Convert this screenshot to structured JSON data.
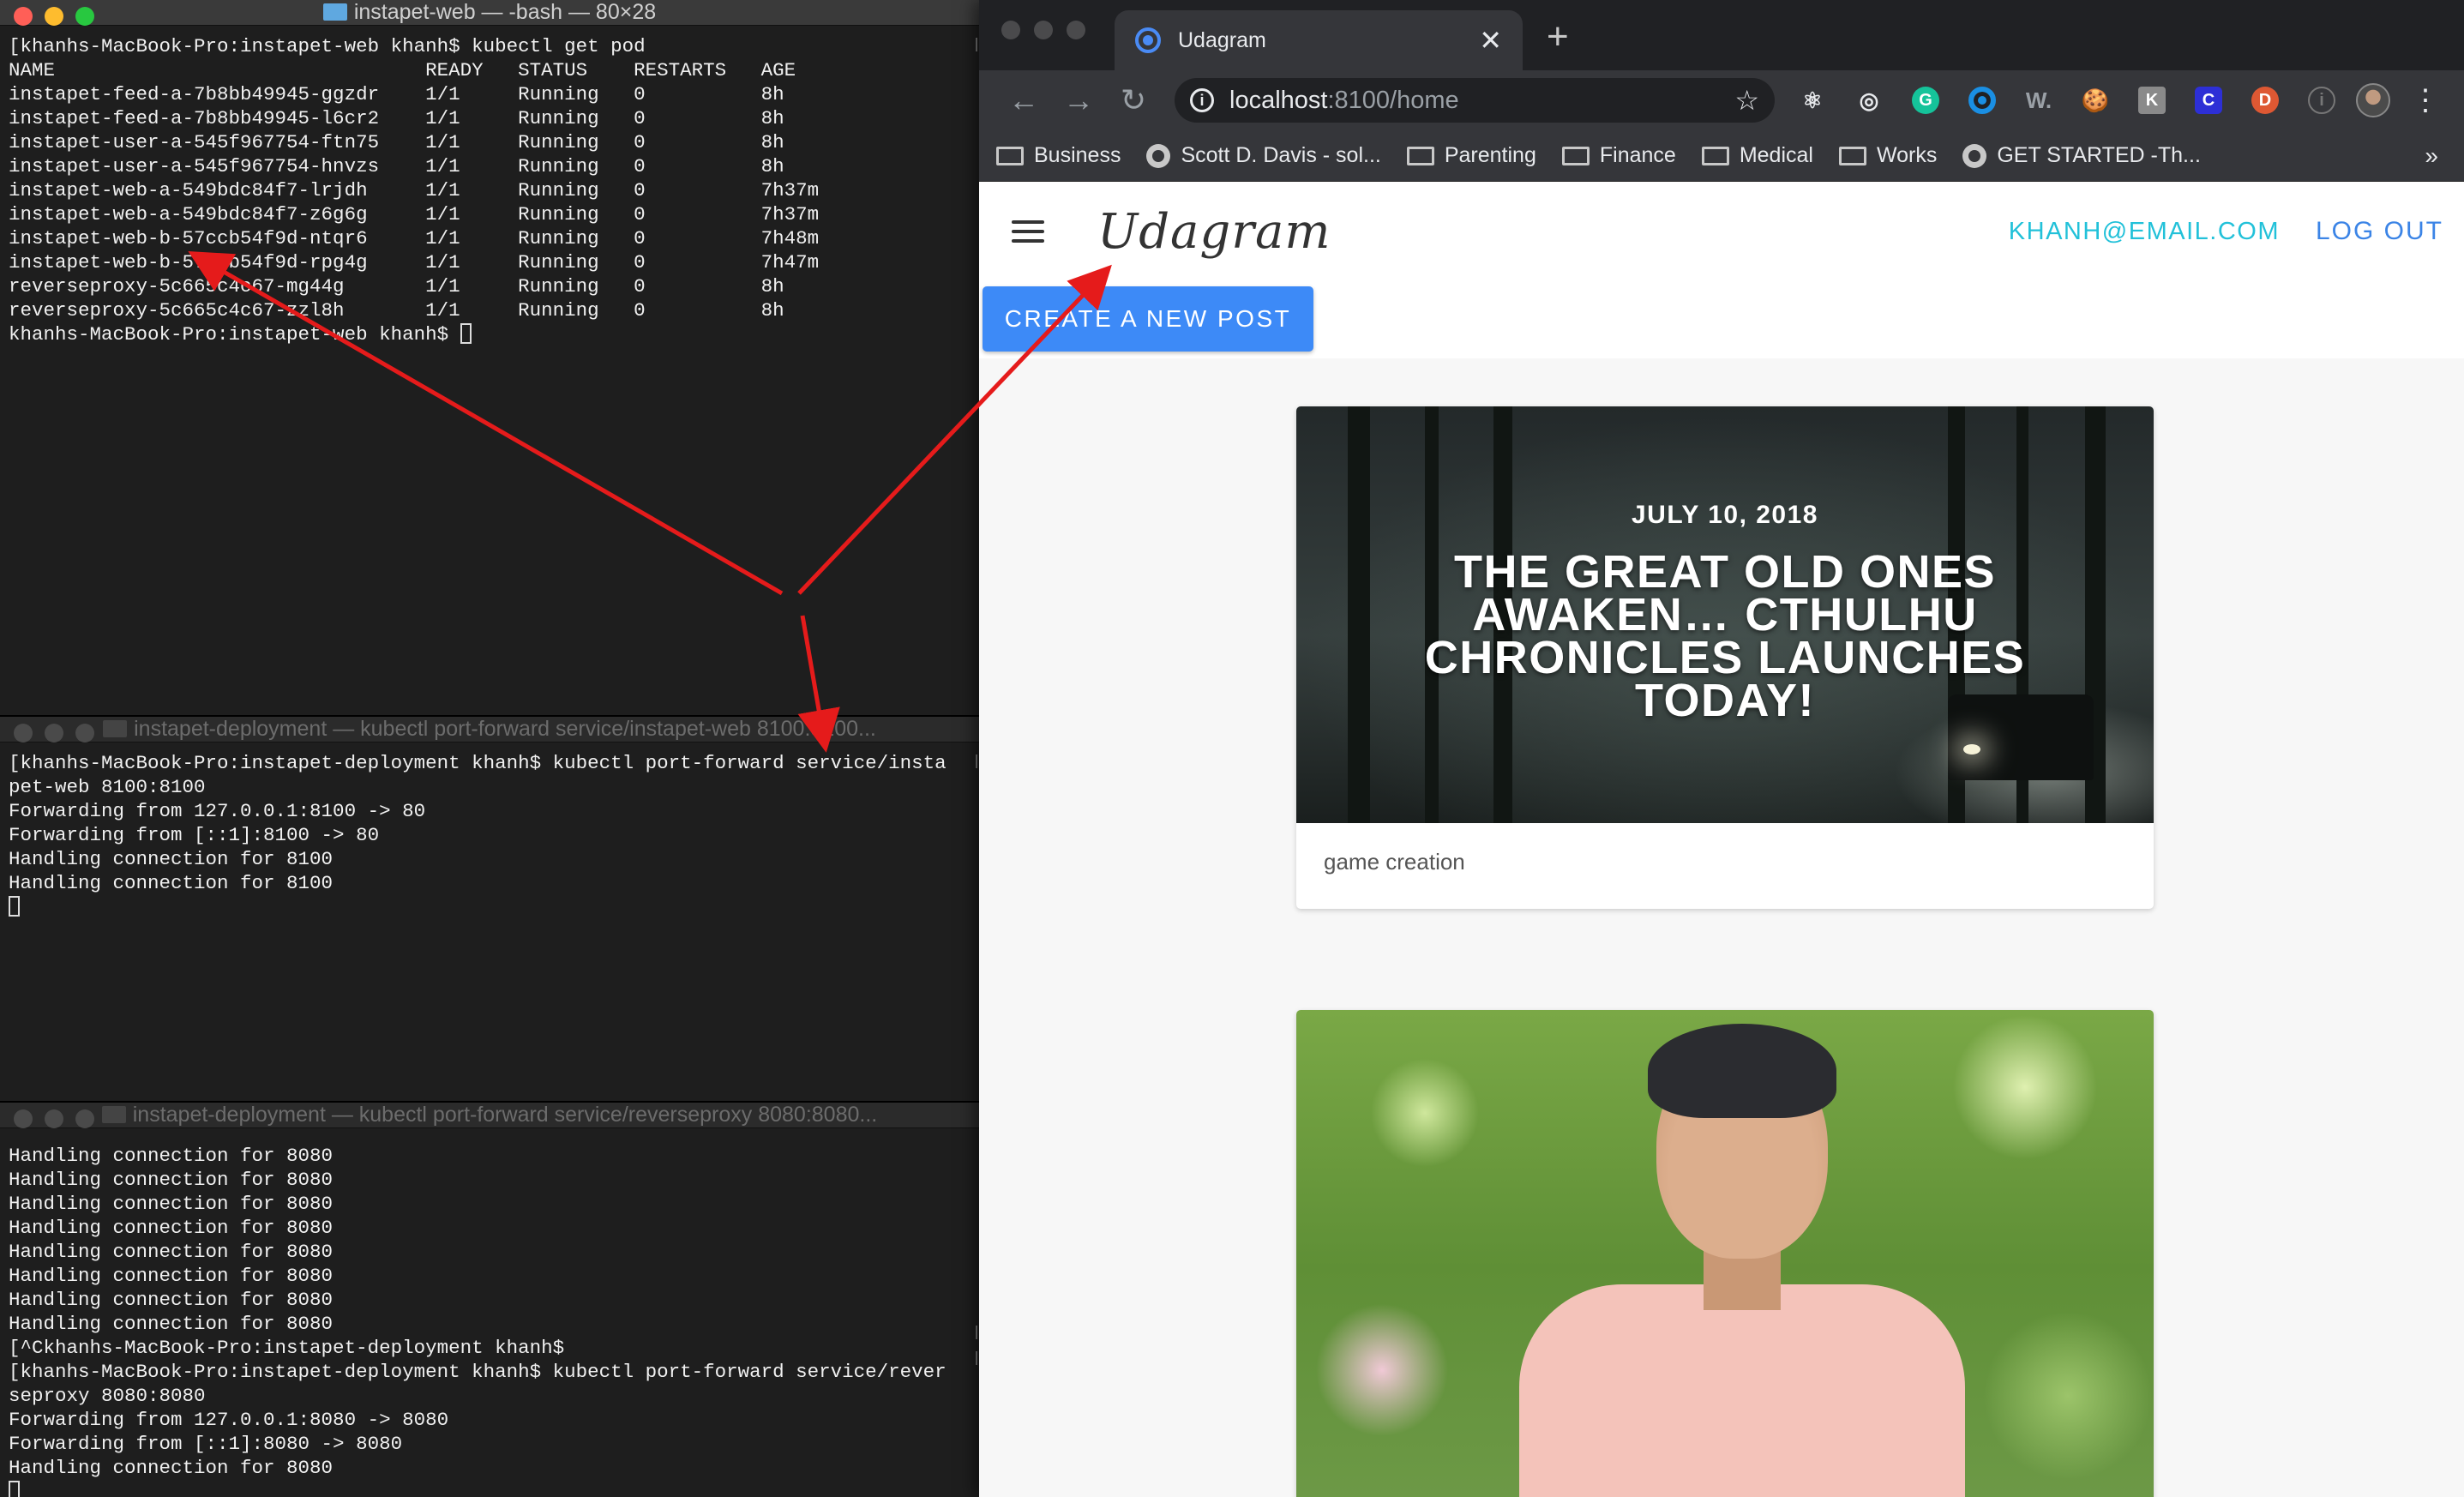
{
  "terminals": {
    "pods": {
      "title": "instapet-web — -bash — 80×28",
      "lines": "[khanhs-MacBook-Pro:instapet-web khanh$ kubectl get pod\nNAME                                READY   STATUS    RESTARTS   AGE\ninstapet-feed-a-7b8bb49945-ggzdr    1/1     Running   0          8h\ninstapet-feed-a-7b8bb49945-l6cr2    1/1     Running   0          8h\ninstapet-user-a-545f967754-ftn75    1/1     Running   0          8h\ninstapet-user-a-545f967754-hnvzs    1/1     Running   0          8h\ninstapet-web-a-549bdc84f7-lrjdh     1/1     Running   0          7h37m\ninstapet-web-a-549bdc84f7-z6g6g     1/1     Running   0          7h37m\ninstapet-web-b-57ccb54f9d-ntqr6     1/1     Running   0          7h48m\ninstapet-web-b-57ccb54f9d-rpg4g     1/1     Running   0          7h47m\nreverseproxy-5c665c4c67-mg44g       1/1     Running   0          8h\nreverseproxy-5c665c4c67-zzl8h       1/1     Running   0          8h\nkhanhs-MacBook-Pro:instapet-web khanh$ "
    },
    "web_forward": {
      "title": "instapet-deployment — kubectl port-forward service/instapet-web 8100:8100...",
      "lines": "[khanhs-MacBook-Pro:instapet-deployment khanh$ kubectl port-forward service/insta\npet-web 8100:8100\nForwarding from 127.0.0.1:8100 -> 80\nForwarding from [::1]:8100 -> 80\nHandling connection for 8100\nHandling connection for 8100\n"
    },
    "proxy_forward": {
      "title": "instapet-deployment — kubectl port-forward service/reverseproxy 8080:8080...",
      "lines": "Handling connection for 8080\nHandling connection for 8080\nHandling connection for 8080\nHandling connection for 8080\nHandling connection for 8080\nHandling connection for 8080\nHandling connection for 8080\nHandling connection for 8080\n[^Ckhanhs-MacBook-Pro:instapet-deployment khanh$\n[khanhs-MacBook-Pro:instapet-deployment khanh$ kubectl port-forward service/rever\nseproxy 8080:8080\nForwarding from 127.0.0.1:8080 -> 8080\nForwarding from [::1]:8080 -> 8080\nHandling connection for 8080\n"
    }
  },
  "browser": {
    "tab_title": "Udagram",
    "new_tab": "+",
    "url_host": "localhost",
    "url_path": ":8100/home",
    "bookmarks": [
      "Business",
      "Scott D. Davis - sol...",
      "Parenting",
      "Finance",
      "Medical",
      "Works",
      "GET STARTED -Th..."
    ],
    "bookmark_more": "»",
    "extensions": {
      "grammarly": "G",
      "wordtune": "W.",
      "cookie": "🍪",
      "k": "K",
      "c": "C",
      "d": "D",
      "i": "i"
    }
  },
  "app": {
    "brand": "Udagram",
    "user_email": "KHANH@EMAIL.COM",
    "logout": "LOG OUT",
    "create_post": "CREATE A NEW POST",
    "posts": [
      {
        "image_date": "JULY 10, 2018",
        "image_title": "THE GREAT OLD ONES AWAKEN… CTHULHU CHRONICLES LAUNCHES TODAY!",
        "caption": "game creation"
      }
    ]
  },
  "colors": {
    "accent_blue": "#3d8af7",
    "email_teal": "#22c1d9",
    "arrow_red": "#e51b1b"
  }
}
